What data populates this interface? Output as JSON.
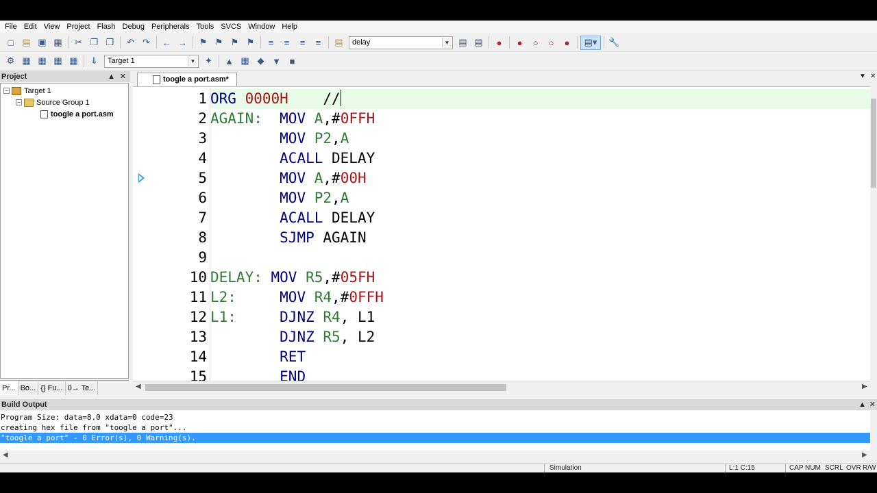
{
  "menu": [
    "File",
    "Edit",
    "View",
    "Project",
    "Flash",
    "Debug",
    "Peripherals",
    "Tools",
    "SVCS",
    "Window",
    "Help"
  ],
  "toolbar": {
    "find_value": "delay",
    "target_value": "Target 1"
  },
  "project": {
    "title": "Project",
    "tree": {
      "target": "Target 1",
      "group": "Source Group 1",
      "file": "toogle a port.asm"
    },
    "tabs": [
      "Pr...",
      "Bo...",
      "{} Fu...",
      "0→ Te..."
    ]
  },
  "editor": {
    "tab_label": "toogle a port.asm*",
    "line_numbers": [
      "1",
      "2",
      "3",
      "4",
      "5",
      "6",
      "7",
      "8",
      "9",
      "10",
      "11",
      "12",
      "13",
      "14",
      "15"
    ]
  },
  "build": {
    "title": "Build Output",
    "lines": [
      "Program Size: data=8.0 xdata=0 code=23",
      "creating hex file from \"toogle a port\"...",
      "\"toogle a port\" - 0 Error(s), 0 Warning(s)."
    ]
  },
  "status": {
    "mode": "Simulation",
    "position": "L:1 C:15",
    "caps": "CAP",
    "num": "NUM",
    "scrl": "SCRL",
    "ovr": "OVR",
    "rw": "R/W"
  },
  "colors": {
    "keyword": "#00007f",
    "label": "#2e7d32",
    "number": "#a31515",
    "selection": "#3399ff",
    "current_line": "#e8fbe8"
  }
}
